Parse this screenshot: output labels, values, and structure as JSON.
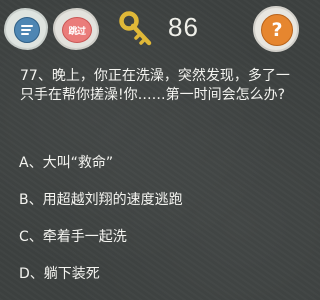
{
  "header": {
    "menu_icon": "menu-icon",
    "skip_label": "跳过",
    "key_icon": "key-icon",
    "key_count": "86",
    "help_icon": "question-mark-icon",
    "help_glyph": "?"
  },
  "question": {
    "text": "77、晚上，你正在洗澡，突然发现，多了一只手在帮你搓澡!你……第一时间会怎么办?"
  },
  "options": [
    {
      "label": "A、大叫“救命”"
    },
    {
      "label": "B、用超越刘翔的速度逃跑"
    },
    {
      "label": "C、牵着手一起洗"
    },
    {
      "label": "D、躺下装死"
    }
  ],
  "colors": {
    "background": "#3d4140",
    "menu_blue": "#4e86b3",
    "skip_red": "#ea7c7a",
    "key_gold": "#e0b838",
    "help_orange": "#e6862f"
  }
}
